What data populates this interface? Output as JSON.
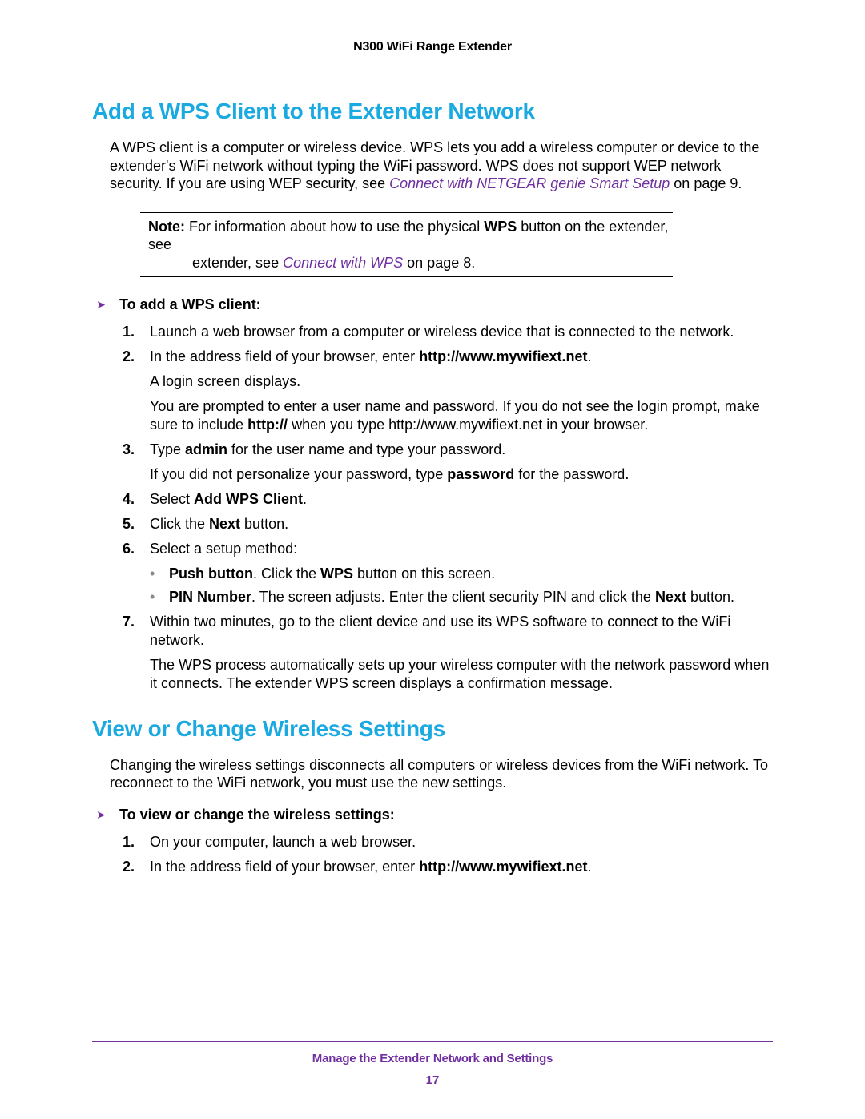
{
  "header": {
    "title": "N300 WiFi Range Extender"
  },
  "section1": {
    "heading": "Add a WPS Client to the Extender Network",
    "intro_a": "A WPS client is a computer or wireless device. WPS lets you add a wireless computer or device to the extender's WiFi network without typing the WiFi password. WPS does not support WEP network security. If you are using WEP security, see ",
    "intro_link": "Connect with NETGEAR genie Smart Setup",
    "intro_b": " on page 9.",
    "note_label": "Note:",
    "note_a": " For information about how to use the physical ",
    "note_bold": "WPS",
    "note_b": " button on the extender, see ",
    "note_link": "Connect with WPS",
    "note_c": " on page 8.",
    "proc_label": "To add a WPS client:",
    "steps": {
      "s1": "Launch a web browser from a computer or wireless device that is connected to the network.",
      "s2_a": "In the address field of your browser, enter ",
      "s2_b": "http://www.mywifiext.net",
      "s2_c": ".",
      "s2_p1": "A login screen displays.",
      "s2_p2a": "You are prompted to enter a user name and password. If you do not see the login prompt, make sure to include ",
      "s2_p2b": "http://",
      "s2_p2c": " when you type http://www.mywifiext.net in your browser.",
      "s3_a": "Type ",
      "s3_b": "admin",
      "s3_c": " for the user name and type your password.",
      "s3_p1a": "If you did not personalize your password, type ",
      "s3_p1b": "password",
      "s3_p1c": " for the password.",
      "s4_a": "Select ",
      "s4_b": "Add WPS Client",
      "s4_c": ".",
      "s5_a": "Click the ",
      "s5_b": "Next",
      "s5_c": " button.",
      "s6": "Select a setup method:",
      "s6_b1_a": "Push button",
      "s6_b1_b": ". Click the ",
      "s6_b1_c": "WPS",
      "s6_b1_d": " button on this screen.",
      "s6_b2_a": "PIN Number",
      "s6_b2_b": ". The screen adjusts. Enter the client security PIN and click the ",
      "s6_b2_c": "Next",
      "s6_b2_d": " button.",
      "s7": "Within two minutes, go to the client device and use its WPS software to connect to the WiFi network.",
      "s7_p1": "The WPS process automatically sets up your wireless computer with the network password when it connects. The extender WPS screen displays a confirmation message."
    },
    "nums": {
      "n1": "1.",
      "n2": "2.",
      "n3": "3.",
      "n4": "4.",
      "n5": "5.",
      "n6": "6.",
      "n7": "7."
    }
  },
  "section2": {
    "heading": "View or Change Wireless Settings",
    "intro": "Changing the wireless settings disconnects all computers or wireless devices from the WiFi network. To reconnect to the WiFi network, you must use the new settings.",
    "proc_label": "To view or change the wireless settings:",
    "steps": {
      "s1": "On your computer, launch a web browser.",
      "s2_a": "In the address field of your browser, enter ",
      "s2_b": "http://www.mywifiext.net",
      "s2_c": "."
    },
    "nums": {
      "n1": "1.",
      "n2": "2."
    }
  },
  "footer": {
    "text": "Manage the Extender Network and Settings",
    "page": "17"
  }
}
